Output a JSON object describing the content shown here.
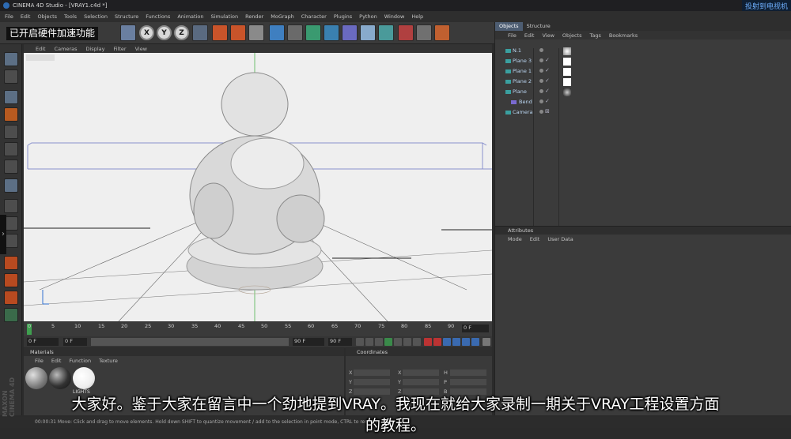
{
  "window": {
    "title": "CINEMA 4D Studio - [VRAY1.c4d *]"
  },
  "overlay": {
    "cast_label": "投射到电视机",
    "hw_accel_label": "已开启硬件加速功能"
  },
  "menubar": [
    "File",
    "Edit",
    "Objects",
    "Tools",
    "Selection",
    "Structure",
    "Functions",
    "Animation",
    "Simulation",
    "Render",
    "MoGraph",
    "Character",
    "Plugins",
    "Python",
    "Window",
    "Help"
  ],
  "toolbar": {
    "axes": [
      "X",
      "Y",
      "Z"
    ]
  },
  "viewport": {
    "menu": [
      "Edit",
      "Cameras",
      "Display",
      "Filter",
      "View"
    ]
  },
  "timeline": {
    "ticks": [
      "0",
      "5",
      "10",
      "15",
      "20",
      "25",
      "30",
      "35",
      "40",
      "45",
      "50",
      "55",
      "60",
      "65",
      "70",
      "75",
      "80",
      "85",
      "90"
    ],
    "frame_end": "0 F",
    "start_field": "0 F",
    "range_field": "0 F",
    "end_field": "90 F",
    "end_field2": "90 F"
  },
  "materials": {
    "header": "Materials",
    "menu": [
      "File",
      "Edit",
      "Function",
      "Texture"
    ],
    "items": [
      {
        "name": "",
        "color": "#9a9a9a"
      },
      {
        "name": "",
        "color": "#333333"
      },
      {
        "name": "LIGHTS",
        "color": "#f2f2f2"
      }
    ]
  },
  "coordinates": {
    "header": "Coordinates",
    "rows": [
      {
        "a": "X",
        "b": "X",
        "c": "H"
      },
      {
        "a": "Y",
        "b": "Y",
        "c": "P"
      },
      {
        "a": "Z",
        "b": "Z",
        "c": "B"
      }
    ]
  },
  "objects": {
    "tabs": [
      "Objects",
      "Structure"
    ],
    "menu": [
      "File",
      "Edit",
      "View",
      "Objects",
      "Tags",
      "Bookmarks"
    ],
    "items": [
      {
        "name": "N.1",
        "indent": 0
      },
      {
        "name": "Plane 3",
        "indent": 0
      },
      {
        "name": "Plane 1",
        "indent": 0
      },
      {
        "name": "Plane 2",
        "indent": 0
      },
      {
        "name": "Plane",
        "indent": 0
      },
      {
        "name": "Bend",
        "indent": 1
      },
      {
        "name": "Camera",
        "indent": 0
      }
    ]
  },
  "attributes": {
    "header": "Attributes",
    "menu": [
      "Mode",
      "Edit",
      "User Data"
    ]
  },
  "status": {
    "text": "00:00:31   Move: Click and drag to move elements. Hold down SHIFT to quantize movement / add to the selection in point mode, CTRL to remove."
  },
  "branding": {
    "maxon": "MAXON CINEMA 4D"
  },
  "subtitles": {
    "line1": "大家好。鉴于大家在留言中一个劲地提到VRAY。我现在就给大家录制一期关于VRAY工程设置方面",
    "line2": "的教程。"
  }
}
